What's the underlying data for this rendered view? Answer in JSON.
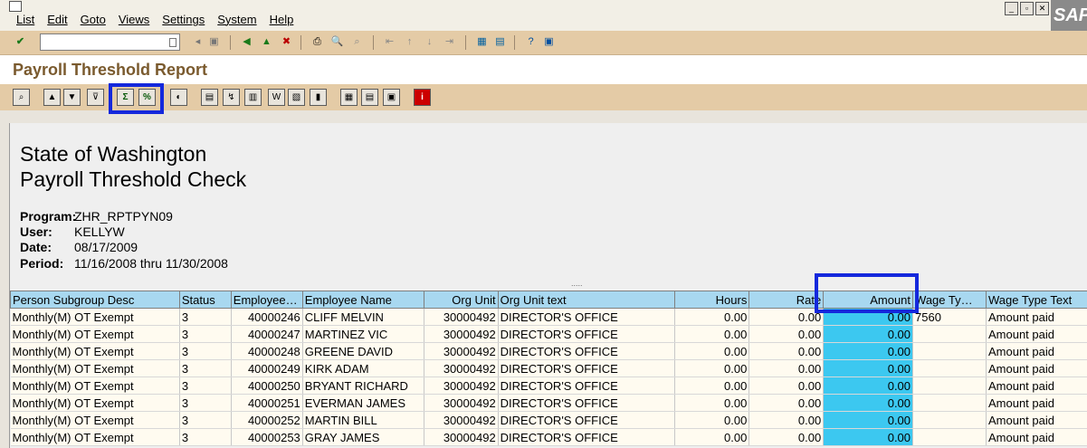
{
  "menubar": {
    "items": [
      "List",
      "Edit",
      "Goto",
      "Views",
      "Settings",
      "System",
      "Help"
    ],
    "brand": "SAP"
  },
  "screen": {
    "title": "Payroll Threshold Report"
  },
  "report": {
    "heading1": "State of Washington",
    "heading2": "Payroll Threshold Check",
    "program_label": "Program:",
    "program_value": "ZHR_RPTPYN09",
    "user_label": "User:",
    "user_value": "KELLYW",
    "date_label": "Date:",
    "date_value": "08/17/2009",
    "period_label": "Period:",
    "period_value": "11/16/2008 thru 11/30/2008"
  },
  "grid": {
    "columns": [
      "Person Subgroup Desc",
      "Status",
      "Employee…",
      "Employee Name",
      "Org Unit",
      "Org Unit text",
      "Hours",
      "Rate",
      "Amount",
      "Wage Ty…",
      "Wage Type Text"
    ],
    "rows": [
      [
        "Monthly(M) OT Exempt",
        "3",
        "40000246",
        "CLIFF MELVIN",
        "30000492",
        "DIRECTOR'S OFFICE",
        "0.00",
        "0.00",
        "0.00",
        "7560",
        "Amount paid"
      ],
      [
        "Monthly(M) OT Exempt",
        "3",
        "40000247",
        "MARTINEZ VIC",
        "30000492",
        "DIRECTOR'S OFFICE",
        "0.00",
        "0.00",
        "0.00",
        "",
        "Amount paid"
      ],
      [
        "Monthly(M) OT Exempt",
        "3",
        "40000248",
        "GREENE DAVID",
        "30000492",
        "DIRECTOR'S OFFICE",
        "0.00",
        "0.00",
        "0.00",
        "",
        "Amount paid"
      ],
      [
        "Monthly(M) OT Exempt",
        "3",
        "40000249",
        "KIRK ADAM",
        "30000492",
        "DIRECTOR'S OFFICE",
        "0.00",
        "0.00",
        "0.00",
        "",
        "Amount paid"
      ],
      [
        "Monthly(M) OT Exempt",
        "3",
        "40000250",
        "BRYANT RICHARD",
        "30000492",
        "DIRECTOR'S OFFICE",
        "0.00",
        "0.00",
        "0.00",
        "",
        "Amount paid"
      ],
      [
        "Monthly(M) OT Exempt",
        "3",
        "40000251",
        "EVERMAN JAMES",
        "30000492",
        "DIRECTOR'S OFFICE",
        "0.00",
        "0.00",
        "0.00",
        "",
        "Amount paid"
      ],
      [
        "Monthly(M) OT Exempt",
        "3",
        "40000252",
        "MARTIN BILL",
        "30000492",
        "DIRECTOR'S OFFICE",
        "0.00",
        "0.00",
        "0.00",
        "",
        "Amount paid"
      ],
      [
        "Monthly(M) OT Exempt",
        "3",
        "40000253",
        "GRAY JAMES",
        "30000492",
        "DIRECTOR'S OFFICE",
        "0.00",
        "0.00",
        "0.00",
        "",
        "Amount paid"
      ]
    ]
  },
  "colors": {
    "toolbar": "#e4cba6",
    "grid_header": "#a8d8f0",
    "amount_column": "#3cc8f0",
    "highlight_box": "#1428dc",
    "title_text": "#7a5a2e"
  }
}
